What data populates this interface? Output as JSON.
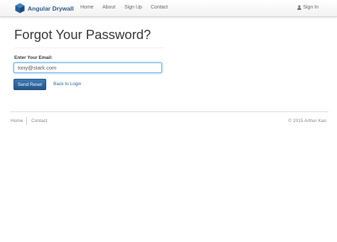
{
  "navbar": {
    "brand": {
      "logo_icon": "hexagon-logo-icon",
      "name": "Angular Drywall",
      "color": "#2a5a8a"
    },
    "links": [
      "Home",
      "About",
      "Sign Up",
      "Contact"
    ],
    "sign_in": {
      "icon": "user-icon",
      "label": "Sign In"
    }
  },
  "main": {
    "title": "Forgot Your Password?",
    "email_label": "Enter Your Email:",
    "email_value": "tony@stark.com",
    "submit_label": "Send Reset",
    "back_link_label": "Back to Login",
    "accent_color": "#2d6aa3"
  },
  "footer": {
    "links": [
      "Home",
      "Contact"
    ],
    "copyright": "© 2015 Arthur Kao"
  }
}
